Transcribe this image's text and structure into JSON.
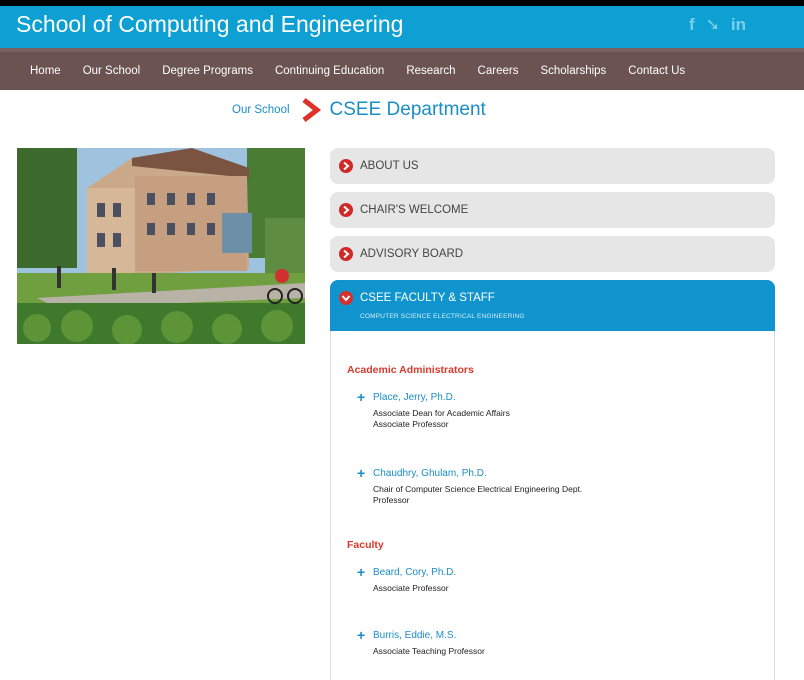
{
  "header": {
    "title": "School of Computing and Engineering",
    "social": [
      {
        "icon": "facebook-icon",
        "glyph": "f"
      },
      {
        "icon": "twitter-icon",
        "glyph": "➘"
      },
      {
        "icon": "linkedin-icon",
        "glyph": "in"
      }
    ]
  },
  "nav": {
    "items": [
      "Home",
      "Our School",
      "Degree Programs",
      "Continuing Education",
      "Research",
      "Careers",
      "Scholarships",
      "Contact Us"
    ]
  },
  "breadcrumb": {
    "parent": "Our School",
    "current": "CSEE Department"
  },
  "accordion": {
    "panels": [
      {
        "title": "ABOUT US"
      },
      {
        "title": "CHAIR'S WELCOME"
      },
      {
        "title": "ADVISORY BOARD"
      }
    ],
    "open_panel": {
      "title": "CSEE FACULTY & STAFF",
      "subtitle": "COMPUTER SCIENCE ELECTRICAL ENGINEERING"
    }
  },
  "staff": {
    "sections": [
      {
        "heading": "Academic Administrators",
        "people": [
          {
            "name": "Place, Jerry, Ph.D.",
            "roles": [
              "Associate Dean for Academic Affairs",
              "Associate Professor"
            ]
          },
          {
            "name": "Chaudhry, Ghulam, Ph.D.",
            "roles": [
              "Chair of Computer Science Electrical Engineering Dept.",
              "Professor"
            ]
          }
        ]
      },
      {
        "heading": "Faculty",
        "people": [
          {
            "name": "Beard, Cory, Ph.D.",
            "roles": [
              "Associate Professor"
            ]
          },
          {
            "name": "Burris, Eddie, M.S.",
            "roles": [
              "Associate Teaching Professor"
            ]
          }
        ]
      }
    ]
  },
  "colors": {
    "header_blue": "#0fa0d3",
    "nav_brown": "#6b5352",
    "accent_red": "#cf2a28",
    "link_blue": "#1a8ec7"
  }
}
